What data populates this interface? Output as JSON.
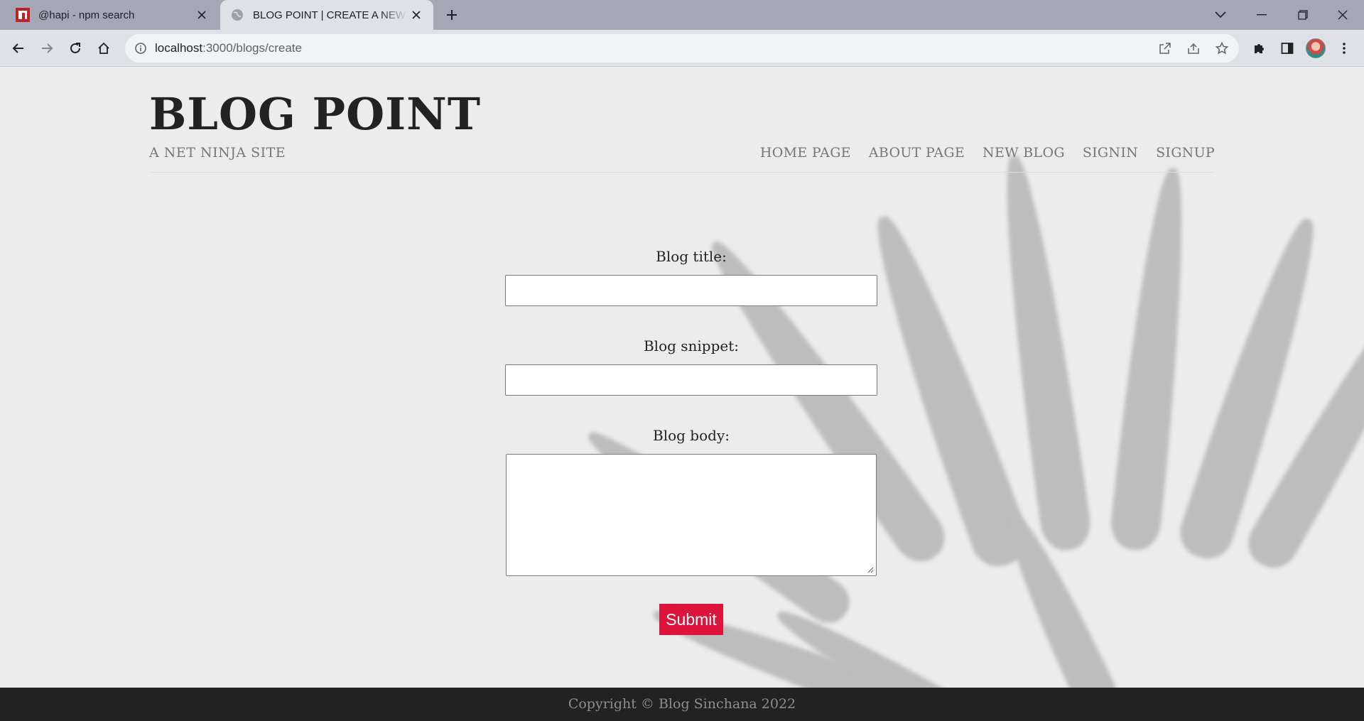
{
  "browser": {
    "tabs": [
      {
        "title": "@hapi - npm search",
        "favicon": "npm-icon",
        "active": false
      },
      {
        "title": "BLOG POINT | CREATE A NEW BLOG",
        "favicon": "globe-icon",
        "active": true
      }
    ],
    "url_host": "localhost",
    "url_path": ":3000/blogs/create"
  },
  "site": {
    "title": "BLOG POINT",
    "tagline": "A NET NINJA SITE",
    "nav": [
      "HOME PAGE",
      "ABOUT PAGE",
      "NEW BLOG",
      "SIGNIN",
      "SIGNUP"
    ]
  },
  "form": {
    "title_label": "Blog title:",
    "title_value": "",
    "snippet_label": "Blog snippet:",
    "snippet_value": "",
    "body_label": "Blog body:",
    "body_value": "",
    "submit_label": "Submit"
  },
  "footer": {
    "text": "Copyright © Blog Sinchana 2022"
  },
  "colors": {
    "accent": "#dc143c",
    "footer_bg": "#222222",
    "page_bg": "#ececec"
  }
}
